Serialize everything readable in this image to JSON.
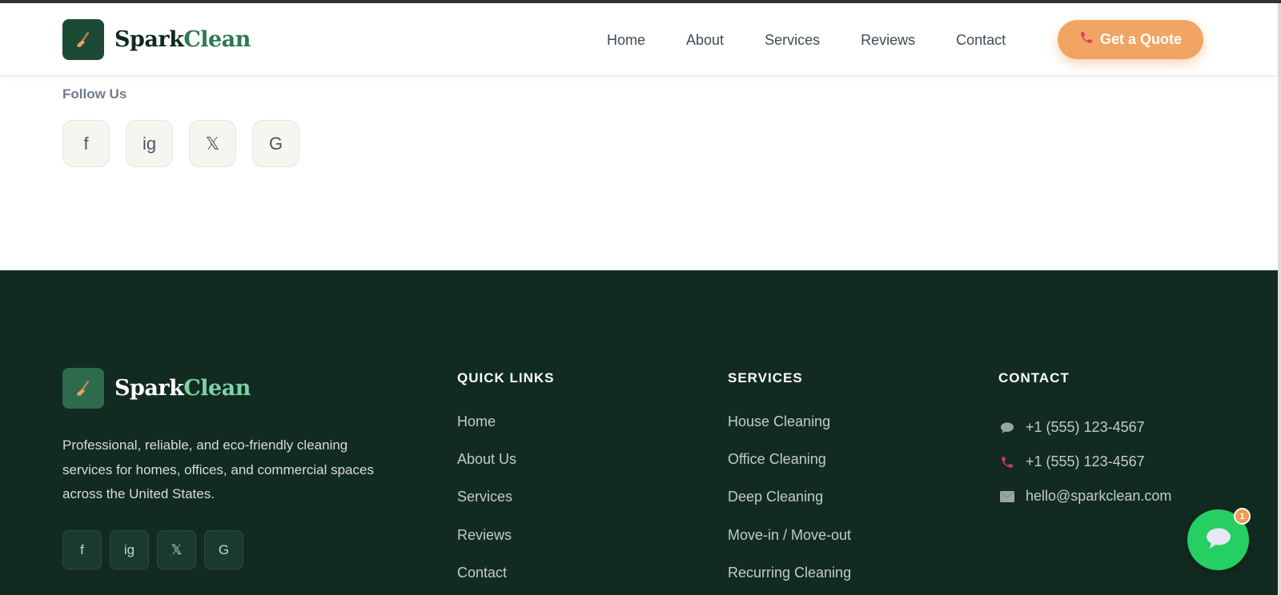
{
  "header": {
    "brand_part1": "Spark",
    "brand_part2": "Clean",
    "nav": [
      "Home",
      "About",
      "Services",
      "Reviews",
      "Contact"
    ],
    "cta_label": "Get a Quote",
    "cta_icon": "phone-icon"
  },
  "follow": {
    "label": "Follow Us",
    "social": [
      "f",
      "ig",
      "𝕏",
      "G"
    ]
  },
  "footer": {
    "brand_part1": "Spark",
    "brand_part2": "Clean",
    "description": "Professional, reliable, and eco-friendly cleaning services for homes, offices, and commercial spaces across the United States.",
    "social": [
      "f",
      "ig",
      "𝕏",
      "G"
    ],
    "quick_links": {
      "title": "QUICK LINKS",
      "items": [
        "Home",
        "About Us",
        "Services",
        "Reviews",
        "Contact"
      ]
    },
    "services": {
      "title": "SERVICES",
      "items": [
        "House Cleaning",
        "Office Cleaning",
        "Deep Cleaning",
        "Move-in / Move-out",
        "Recurring Cleaning"
      ]
    },
    "contact": {
      "title": "CONTACT",
      "whatsapp": "+1 (555) 123-4567",
      "phone": "+1 (555) 123-4567",
      "email": "hello@sparkclean.com"
    }
  },
  "chat": {
    "badge_count": "1"
  },
  "colors": {
    "brand_dark": "#1d4a35",
    "brand_green": "#2d7a52",
    "footer_bg": "#122b21",
    "accent_orange": "#f2a463",
    "chat_green": "#25cf62"
  }
}
